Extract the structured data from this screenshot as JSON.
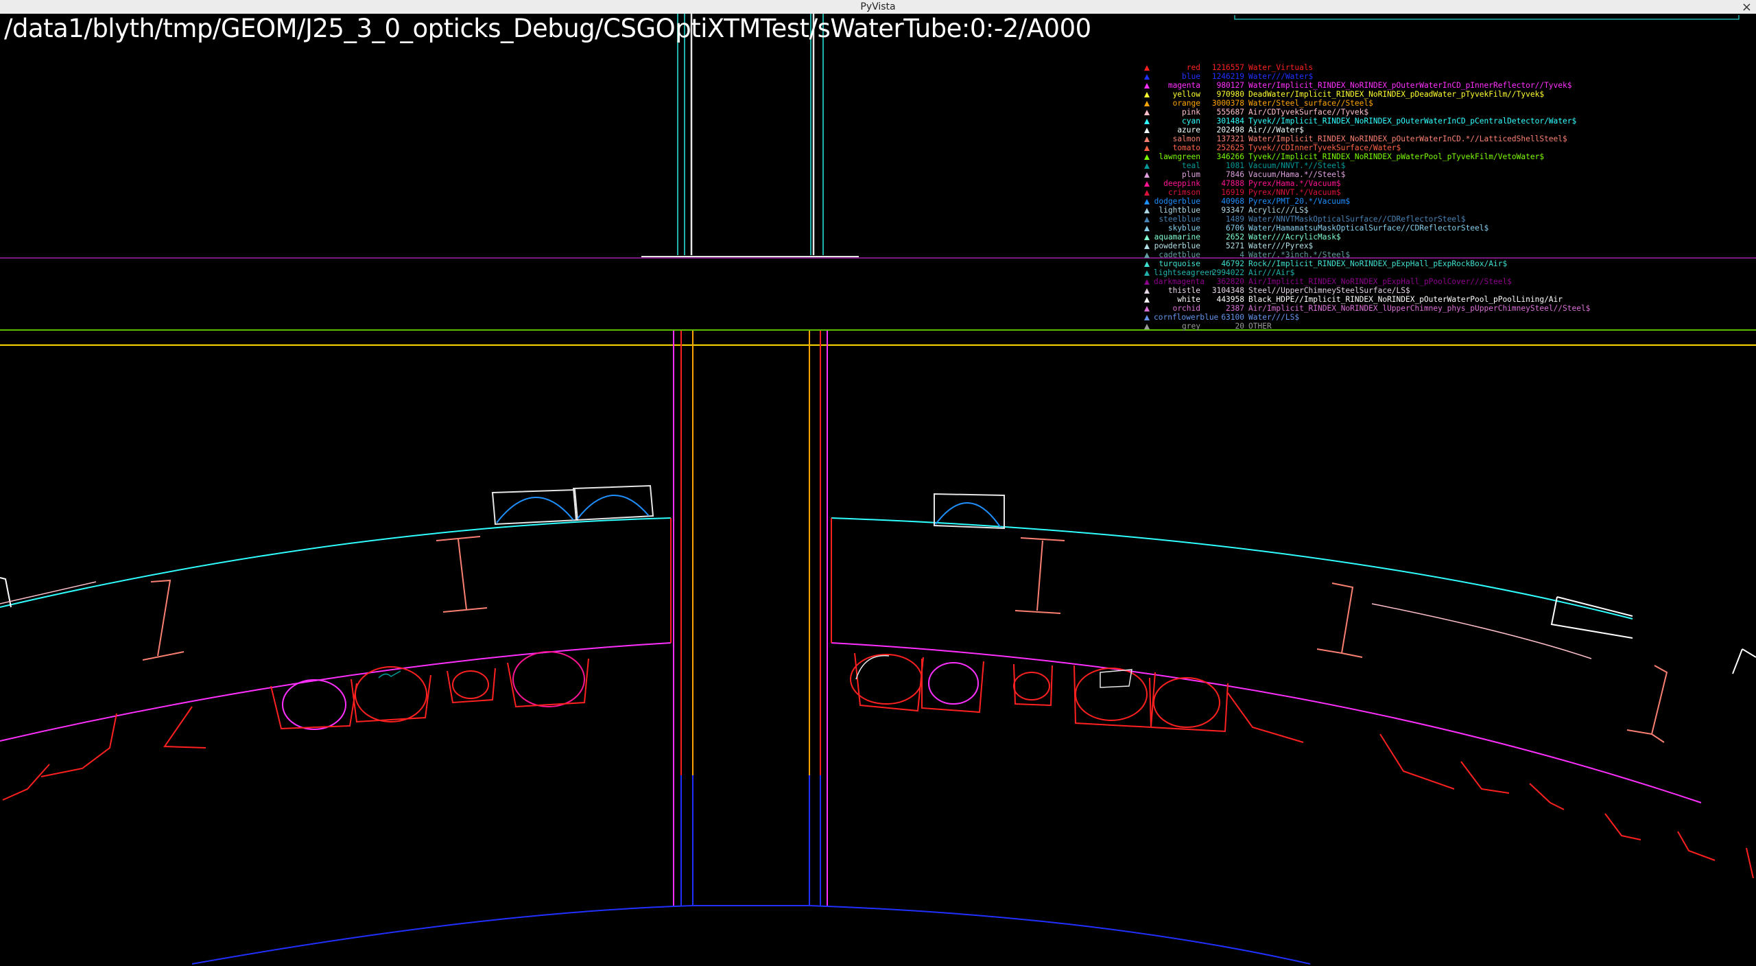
{
  "window": {
    "title": "PyVista",
    "close_glyph": "×"
  },
  "viewport": {
    "path_label": "/data1/blyth/tmp/GEOM/J25_3_0_opticks_Debug/CSGOptiXTMTest/sWaterTube:0:-2/A000"
  },
  "legend": [
    {
      "name": "red",
      "count": "1216557",
      "label": "Water_Virtuals",
      "color": "#ff2020"
    },
    {
      "name": "blue",
      "count": "1246219",
      "label": "Water///Water$",
      "color": "#2030ff"
    },
    {
      "name": "magenta",
      "count": "980127",
      "label": "Water/Implicit_RINDEX_NoRINDEX_pOuterWaterInCD_pInnerReflector//Tyvek$",
      "color": "#ff30ff"
    },
    {
      "name": "yellow",
      "count": "970980",
      "label": "DeadWater/Implicit_RINDEX_NoRINDEX_pDeadWater_pTyvekFilm//Tyvek$",
      "color": "#ffff30"
    },
    {
      "name": "orange",
      "count": "3000378",
      "label": "Water/Steel_surface//Steel$",
      "color": "#ffa500"
    },
    {
      "name": "pink",
      "count": "555687",
      "label": "Air/CDTyvekSurface//Tyvek$",
      "color": "#ffc0cb"
    },
    {
      "name": "cyan",
      "count": "301484",
      "label": "Tyvek//Implicit_RINDEX_NoRINDEX_pOuterWaterInCD_pCentralDetector/Water$",
      "color": "#30ffff"
    },
    {
      "name": "azure",
      "count": "202498",
      "label": "Air///Water$",
      "color": "#f0ffff"
    },
    {
      "name": "salmon",
      "count": "137321",
      "label": "Water/Implicit_RINDEX_NoRINDEX_pOuterWaterInCD.*//LatticedShellSteel$",
      "color": "#fa8072"
    },
    {
      "name": "tomato",
      "count": "252625",
      "label": "Tyvek//CDInnerTyvekSurface/Water$",
      "color": "#ff6347"
    },
    {
      "name": "lawngreen",
      "count": "346266",
      "label": "Tyvek//Implicit_RINDEX_NoRINDEX_pWaterPool_pTyvekFilm/VetoWater$",
      "color": "#7cfc00"
    },
    {
      "name": "teal",
      "count": "1081",
      "label": "Vacuum/NNVT.*//Steel$",
      "color": "#009a9a"
    },
    {
      "name": "plum",
      "count": "7846",
      "label": "Vacuum/Hama.*//Steel$",
      "color": "#dda0dd"
    },
    {
      "name": "deeppink",
      "count": "47888",
      "label": "Pyrex/Hama.*/Vacuum$",
      "color": "#ff1493"
    },
    {
      "name": "crimson",
      "count": "16919",
      "label": "Pyrex/NNVT.*/Vacuum$",
      "color": "#dc143c"
    },
    {
      "name": "dodgerblue",
      "count": "40968",
      "label": "Pyrex/PMT_20.*/Vacuum$",
      "color": "#1e90ff"
    },
    {
      "name": "lightblue",
      "count": "93347",
      "label": "Acrylic///LS$",
      "color": "#add8e6"
    },
    {
      "name": "steelblue",
      "count": "1489",
      "label": "Water/NNVTMaskOpticalSurface//CDReflectorSteel$",
      "color": "#4682b4"
    },
    {
      "name": "skyblue",
      "count": "6706",
      "label": "Water/HamamatsuMaskOpticalSurface//CDReflectorSteel$",
      "color": "#87ceeb"
    },
    {
      "name": "aquamarine",
      "count": "2652",
      "label": "Water///AcrylicMask$",
      "color": "#7fffd4"
    },
    {
      "name": "powderblue",
      "count": "5271",
      "label": "Water///Pyrex$",
      "color": "#b0e0e6"
    },
    {
      "name": "cadetblue",
      "count": "4",
      "label": "Water/.*3inch.*/Steel$",
      "color": "#5f9ea0"
    },
    {
      "name": "turquoise",
      "count": "46792",
      "label": "Rock//Implicit_RINDEX_NoRINDEX_pExpHall_pExpRockBox/Air$",
      "color": "#40e0d0"
    },
    {
      "name": "lightseagreen",
      "count": "2994022",
      "label": "Air///Air$",
      "color": "#20b2aa"
    },
    {
      "name": "darkmagenta",
      "count": "362820",
      "label": "Air/Implicit_RINDEX_NoRINDEX_pExpHall_pPoolCover///Steel$",
      "color": "#8b008b"
    },
    {
      "name": "thistle",
      "count": "3104348",
      "label": "Steel//UpperChimneySteelSurface/LS$",
      "color": "#e6d5e6"
    },
    {
      "name": "white",
      "count": "443958",
      "label": "Black_HDPE//Implicit_RINDEX_NoRINDEX_pOuterWaterPool_pPoolLining/Air",
      "color": "#ffffff"
    },
    {
      "name": "orchid",
      "count": "2387",
      "label": "Air/Implicit_RINDEX_NoRINDEX_lUpperChimney_phys_pUpperChimneySteel//Steel$",
      "color": "#da70d6"
    },
    {
      "name": "cornflowerblue",
      "count": "63100",
      "label": "Water///LS$",
      "color": "#6495ed"
    },
    {
      "name": "grey",
      "count": "20",
      "label": "OTHER",
      "color": "#9a9a9a"
    }
  ]
}
